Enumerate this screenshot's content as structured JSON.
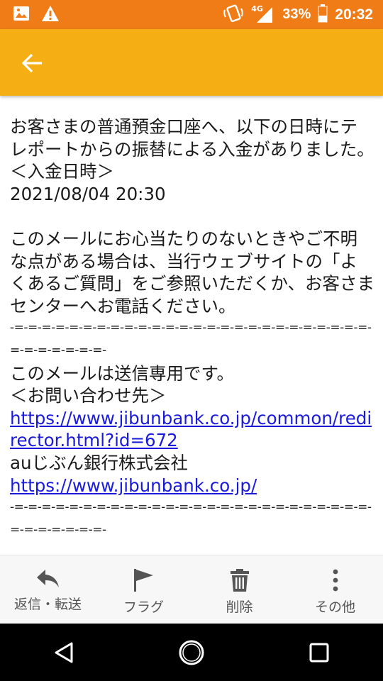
{
  "status_bar": {
    "network_label": "4G",
    "battery_percent": "33%",
    "time": "20:32"
  },
  "message": {
    "intro": "お客さまの普通預金口座へ、以下の日時にテレポートからの振替による入金がありました。",
    "deposit_label": "＜入金日時＞",
    "deposit_datetime": "2021/08/04 20:30",
    "notice": "このメールにお心当たりのないときやご不明な点がある場合は、当行ウェブサイトの「よくあるご質問」をご参照いただくか、お客さまセンターへお電話ください。",
    "separator": "-=-=-=-=-=-=-=-=-=-=-=-=-=-=-=-=-=-=-=-=-=-=-=-=-=-=-=-=-=-=-=-=-=-",
    "send_only": "このメールは送信専用です。",
    "contact_label": "＜お問い合わせ先＞",
    "contact_link": "https://www.jibunbank.co.jp/common/redirector.html?id=672",
    "company": "auじぶん銀行株式会社",
    "company_link": "https://www.jibunbank.co.jp/"
  },
  "actions": {
    "reply_forward": "返信・転送",
    "flag": "フラグ",
    "delete": "削除",
    "more": "その他"
  },
  "colors": {
    "status_bar": "#f07c17",
    "app_bar": "#f6ae15",
    "link": "#1a1adb"
  },
  "icons": {
    "back": "arrow-left",
    "reply": "reply-arrow",
    "flag": "flag",
    "delete": "trash-can",
    "more": "vertical-dots"
  }
}
